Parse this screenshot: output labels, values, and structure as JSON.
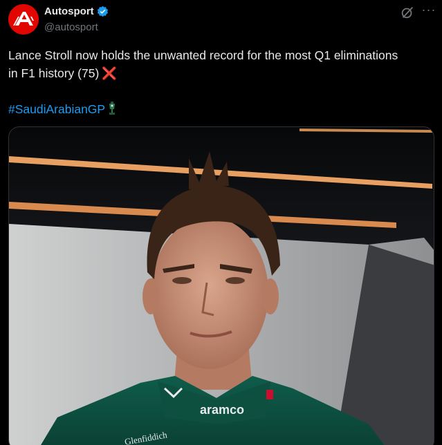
{
  "author": {
    "display_name": "Autosport",
    "handle": "@autosport",
    "avatar_icon": "autosport-logo-icon",
    "verified_color": "#1d9bf0"
  },
  "header_actions": {
    "grok_icon": "grok-icon",
    "more_label": "···"
  },
  "tweet": {
    "text_line_1": "Lance Stroll now holds the unwanted record for the most Q1 eliminations",
    "text_line_2": "in F1 history (75)",
    "cross_emoji": "❌",
    "hashtag": "#SaudiArabianGP",
    "trophy_emoji_icon": "trophy-emoji-icon",
    "hashtag_color": "#1d9bf0"
  },
  "media": {
    "type": "photo",
    "description_icon": "driver-portrait-photo",
    "suit_sponsor_1": "aramco",
    "suit_sponsor_2": "Glenfiddich"
  }
}
